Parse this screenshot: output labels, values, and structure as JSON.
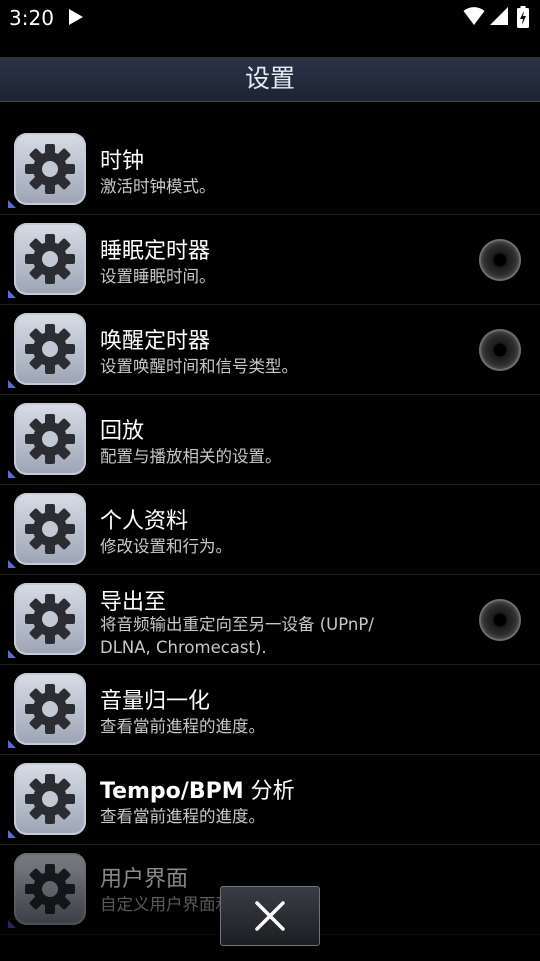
{
  "status_bar": {
    "time": "3:20"
  },
  "header": {
    "title": "设置"
  },
  "settings": [
    {
      "title": "时钟",
      "desc": "激活时钟模式。",
      "has_radio": false
    },
    {
      "title": "睡眠定时器",
      "desc": "设置睡眠时间。",
      "has_radio": true
    },
    {
      "title": "唤醒定时器",
      "desc": "设置唤醒时间和信号类型。",
      "has_radio": true
    },
    {
      "title": "回放",
      "desc": "配置与播放相关的设置。",
      "has_radio": false
    },
    {
      "title": "个人资料",
      "desc": "修改设置和行为。",
      "has_radio": false
    },
    {
      "title": "导出至",
      "desc_line1": "将音频输出重定向至另一设备 (UPnP/",
      "desc_line2": "DLNA, Chromecast).",
      "has_radio": true
    },
    {
      "title": "音量归一化",
      "desc": "查看當前進程的進度。",
      "has_radio": false
    },
    {
      "title_bold": "Tempo/BPM",
      "title_rest": " 分析",
      "desc": "查看當前進程的進度。",
      "has_radio": false
    },
    {
      "title": "用户界面",
      "desc": "自定义用户界面和行为。",
      "has_radio": false
    }
  ],
  "icons": {
    "row_icon": "gear-icon",
    "status": [
      "play-icon",
      "wifi-icon",
      "cell-signal-icon",
      "battery-charging-icon"
    ],
    "close": "close-icon"
  },
  "colors": {
    "title_bar": "#232b3b",
    "background": "#000000",
    "corner_accent": "#5b6bd6"
  }
}
